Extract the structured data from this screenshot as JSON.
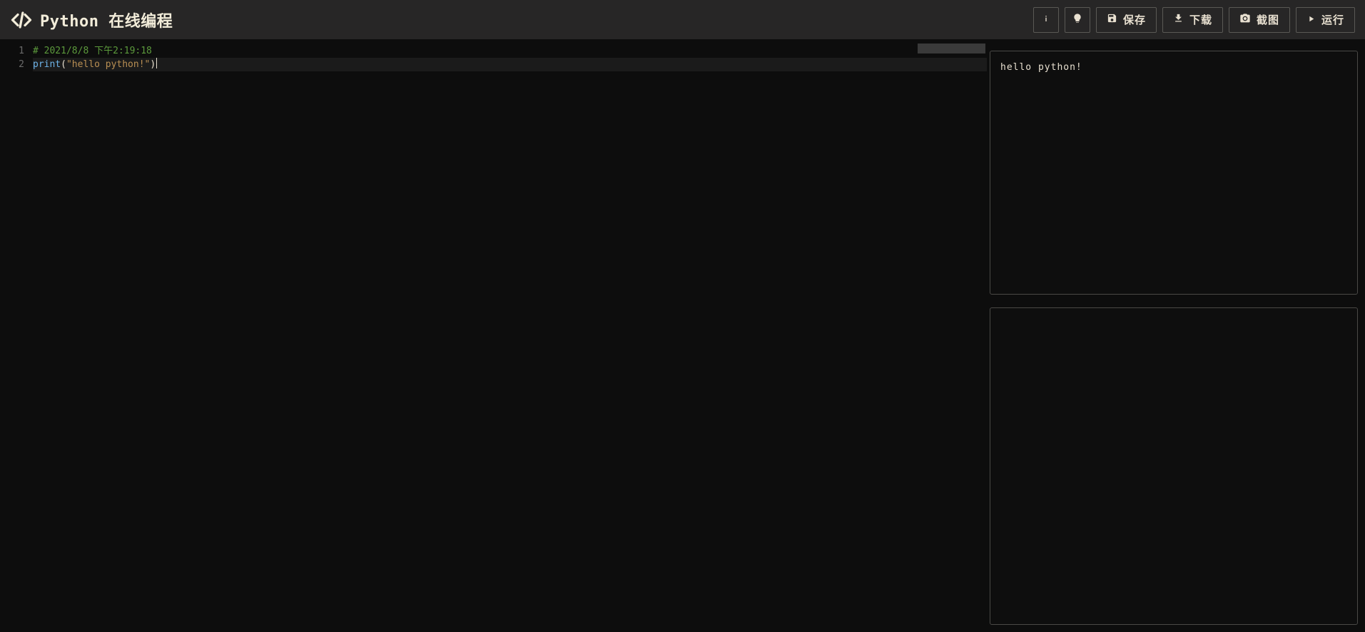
{
  "header": {
    "title": "Python 在线编程",
    "info_icon": "info-icon",
    "bulb_icon": "bulb-icon"
  },
  "toolbar": {
    "save_label": "保存",
    "download_label": "下载",
    "screenshot_label": "截图",
    "run_label": "运行"
  },
  "editor": {
    "lines": [
      {
        "num": "1",
        "tokens": [
          {
            "cls": "tok-comment",
            "text": "# 2021/8/8 下午2:19:18"
          }
        ]
      },
      {
        "num": "2",
        "tokens": [
          {
            "cls": "tok-func",
            "text": "print"
          },
          {
            "cls": "tok-paren",
            "text": "("
          },
          {
            "cls": "tok-str",
            "text": "\"hello python!\""
          },
          {
            "cls": "tok-paren",
            "text": ")"
          }
        ]
      }
    ],
    "active_line": 1
  },
  "output": {
    "text": "hello python!"
  }
}
